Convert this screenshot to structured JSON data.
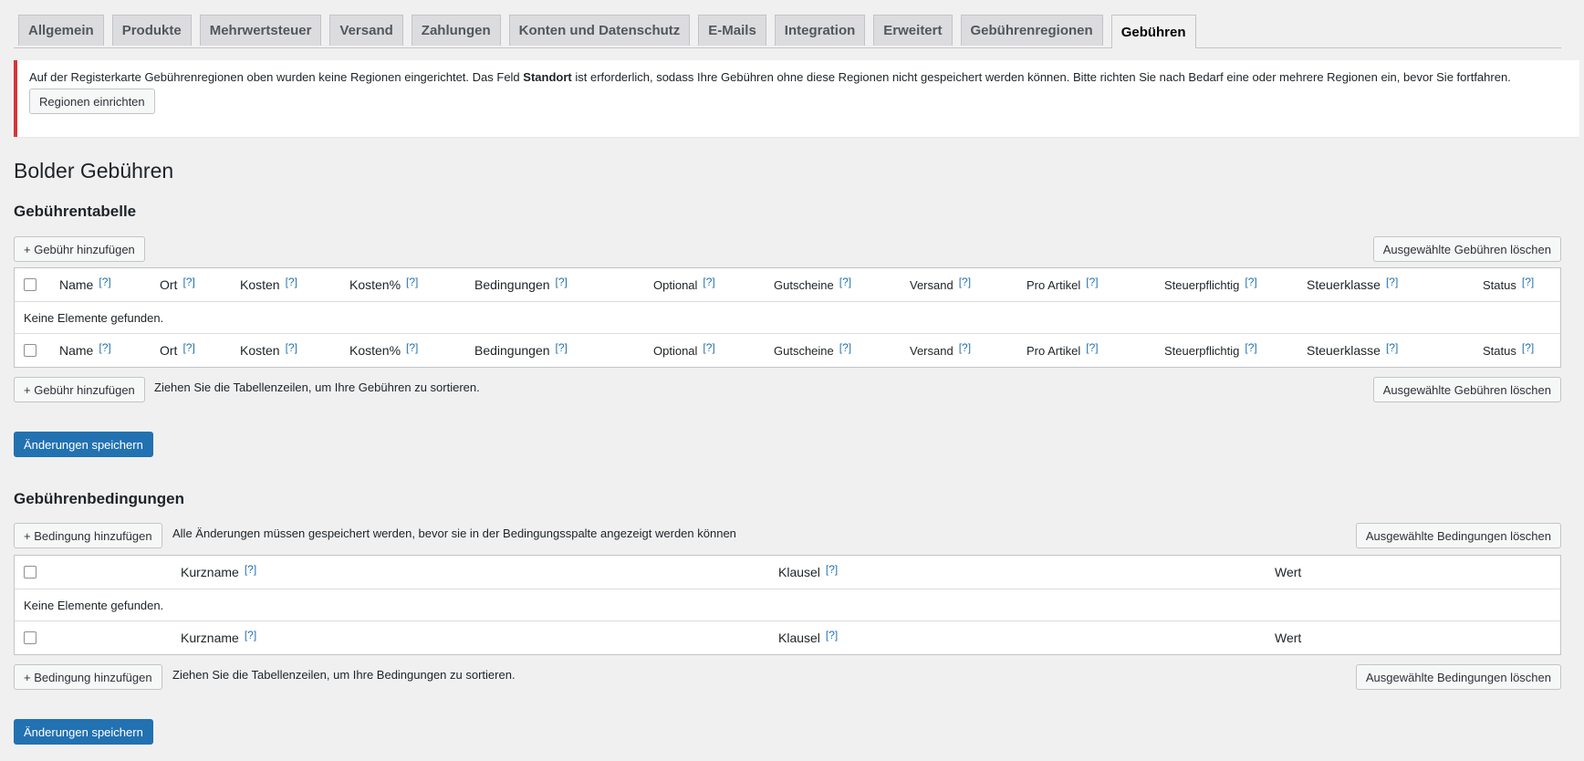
{
  "tabs": [
    {
      "label": "Allgemein"
    },
    {
      "label": "Produkte"
    },
    {
      "label": "Mehrwertsteuer"
    },
    {
      "label": "Versand"
    },
    {
      "label": "Zahlungen"
    },
    {
      "label": "Konten und Datenschutz"
    },
    {
      "label": "E-Mails"
    },
    {
      "label": "Integration"
    },
    {
      "label": "Erweitert"
    },
    {
      "label": "Gebührenregionen"
    },
    {
      "label": "Gebühren"
    }
  ],
  "active_tab": "Gebühren",
  "notice": {
    "text_before": "Auf der Registerkarte Gebührenregionen oben wurden keine Regionen eingerichtet. Das Feld ",
    "text_bold": "Standort",
    "text_after": " ist erforderlich, sodass Ihre Gebühren ohne diese Regionen nicht gespeichert werden können. Bitte richten Sie nach Bedarf eine oder mehrere Regionen ein, bevor Sie fortfahren.",
    "button": "Regionen einrichten",
    "border_color": "#d63638"
  },
  "page_title": "Bolder Gebühren",
  "fees": {
    "heading": "Gebührentabelle",
    "add_button": "+ Gebühr hinzufügen",
    "delete_button": "Ausgewählte Gebühren löschen",
    "sort_hint": "Ziehen Sie die Tabellenzeilen, um Ihre Gebühren zu sortieren.",
    "empty": "Keine Elemente gefunden.",
    "help": "[?]",
    "columns": [
      {
        "label": "Name"
      },
      {
        "label": "Ort"
      },
      {
        "label": "Kosten"
      },
      {
        "label": "Kosten%"
      },
      {
        "label": "Bedingungen"
      },
      {
        "label": "Optional"
      },
      {
        "label": "Gutscheine"
      },
      {
        "label": "Versand"
      },
      {
        "label": "Pro Artikel"
      },
      {
        "label": "Steuerpflichtig"
      },
      {
        "label": "Steuerklasse"
      },
      {
        "label": "Status"
      }
    ]
  },
  "save_button": "Änderungen speichern",
  "conditions": {
    "heading": "Gebührenbedingungen",
    "add_button": "+ Bedingung hinzufügen",
    "note": "Alle Änderungen müssen gespeichert werden, bevor sie in der Bedingungsspalte angezeigt werden können",
    "delete_button": "Ausgewählte Bedingungen löschen",
    "sort_hint": "Ziehen Sie die Tabellenzeilen, um Ihre Bedingungen zu sortieren.",
    "empty": "Keine Elemente gefunden.",
    "help": "[?]",
    "columns": [
      {
        "label": "Kurzname"
      },
      {
        "label": "Klausel"
      },
      {
        "label": "Wert"
      }
    ]
  },
  "colors": {
    "primary": "#2271b1",
    "background": "#f0f0f1",
    "help_link": "#2271b1"
  }
}
